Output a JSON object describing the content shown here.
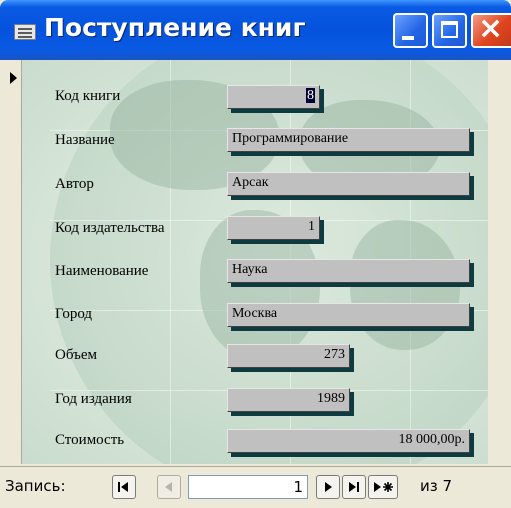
{
  "window": {
    "title": "Поступление книг"
  },
  "form": {
    "fields": [
      {
        "label": "Код книги",
        "value": "8"
      },
      {
        "label": "Название",
        "value": "Программирование"
      },
      {
        "label": "Автор",
        "value": "Арсак"
      },
      {
        "label": "Код издательства",
        "value": "1"
      },
      {
        "label": "Наименование",
        "value": "Наука"
      },
      {
        "label": "Город",
        "value": "Москва"
      },
      {
        "label": "Объем",
        "value": "273"
      },
      {
        "label": "Год издания",
        "value": "1989"
      },
      {
        "label": "Стоимость",
        "value": "18 000,00р."
      }
    ]
  },
  "navigation": {
    "record_label": "Запись:",
    "current_record": "1",
    "of_label": "из 7",
    "buttons": [
      "first-record",
      "previous-record",
      "next-record",
      "last-record",
      "new-record"
    ]
  }
}
